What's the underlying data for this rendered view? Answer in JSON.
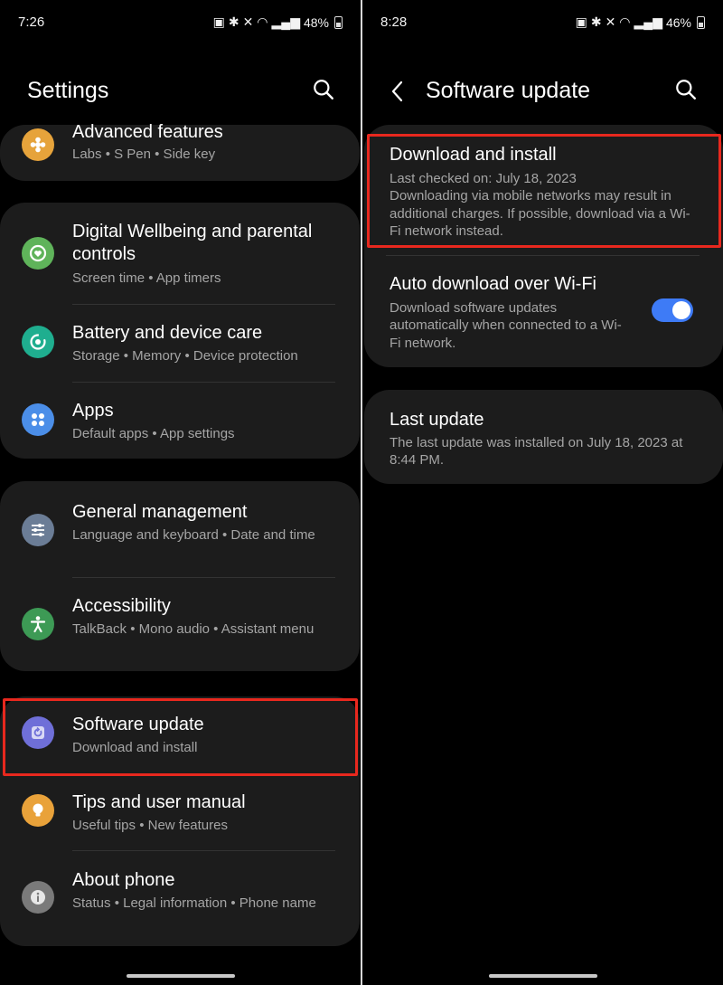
{
  "left": {
    "status": {
      "time": "7:26",
      "battery": "48%"
    },
    "header": {
      "title": "Settings"
    },
    "items": [
      {
        "title": "Advanced features",
        "subtitle": "Labs  •  S Pen  •  Side key",
        "icon": "puzzle-icon",
        "color": "#e6a33b"
      },
      {
        "title": "Digital Wellbeing and parental controls",
        "subtitle": "Screen time  •  App timers",
        "icon": "wellbeing-icon",
        "color": "#5fb35a"
      },
      {
        "title": "Battery and device care",
        "subtitle": "Storage  •  Memory  •  Device protection",
        "icon": "device-care-icon",
        "color": "#1fae8f"
      },
      {
        "title": "Apps",
        "subtitle": "Default apps  •  App settings",
        "icon": "apps-icon",
        "color": "#4b8ee8"
      },
      {
        "title": "General management",
        "subtitle": "Language and keyboard  •  Date and time",
        "icon": "sliders-icon",
        "color": "#6b7d96"
      },
      {
        "title": "Accessibility",
        "subtitle": "TalkBack  •  Mono audio  •  Assistant menu",
        "icon": "accessibility-icon",
        "color": "#3d9a55"
      },
      {
        "title": "Software update",
        "subtitle": "Download and install",
        "icon": "software-update-icon",
        "color": "#6f6fd8"
      },
      {
        "title": "Tips and user manual",
        "subtitle": "Useful tips  •  New features",
        "icon": "bulb-icon",
        "color": "#e9a23a"
      },
      {
        "title": "About phone",
        "subtitle": "Status  •  Legal information  •  Phone name",
        "icon": "info-icon",
        "color": "#7a7a7a"
      }
    ]
  },
  "right": {
    "status": {
      "time": "8:28",
      "battery": "46%"
    },
    "header": {
      "title": "Software update"
    },
    "download": {
      "title": "Download and install",
      "subtitle": "Last checked on: July 18, 2023\nDownloading via mobile networks may result in additional charges. If possible, download via a Wi-Fi network instead."
    },
    "auto": {
      "title": "Auto download over Wi-Fi",
      "subtitle": "Download software updates automatically when connected to a Wi-Fi network.",
      "enabled": true
    },
    "last": {
      "title": "Last update",
      "subtitle": "The last update was installed on July 18, 2023 at 8:44 PM."
    }
  },
  "colors": {
    "highlight": "#e8281e",
    "toggle": "#3e7bf6",
    "card": "#1c1c1c"
  }
}
